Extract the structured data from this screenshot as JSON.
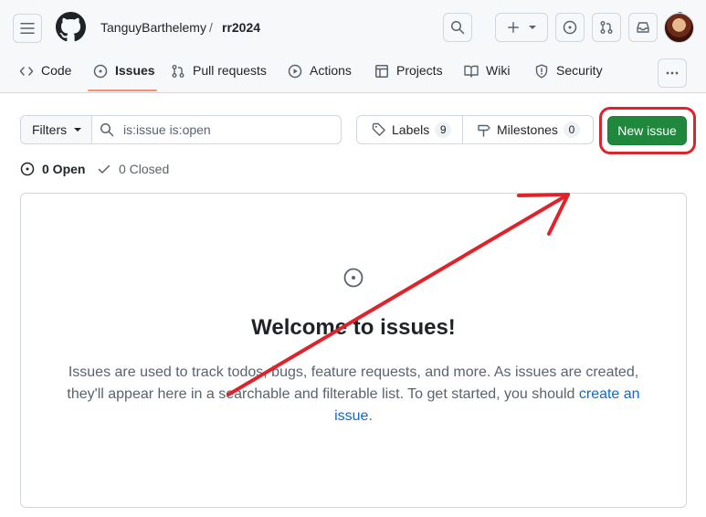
{
  "header": {
    "owner": "TanguyBarthelemy",
    "separator": "/",
    "repo": "rr2024"
  },
  "icons": {
    "menu": "hamburger-icon",
    "logo": "github-octocat-icon",
    "search": "search-icon",
    "create": "plus-icon",
    "issues": "issue-opened-icon",
    "pulls": "git-pull-request-icon",
    "inbox": "inbox-icon",
    "more": "kebab-horizontal-icon"
  },
  "tabs": [
    {
      "label": "Code",
      "icon": "code-icon"
    },
    {
      "label": "Issues",
      "icon": "issue-opened-icon",
      "active": true
    },
    {
      "label": "Pull requests",
      "icon": "git-pull-request-icon"
    },
    {
      "label": "Actions",
      "icon": "play-icon"
    },
    {
      "label": "Projects",
      "icon": "table-icon"
    },
    {
      "label": "Wiki",
      "icon": "book-icon"
    },
    {
      "label": "Security",
      "icon": "shield-icon"
    }
  ],
  "toolbar": {
    "filters_label": "Filters",
    "search_value": "is:issue is:open",
    "labels_label": "Labels",
    "labels_count": "9",
    "milestones_label": "Milestones",
    "milestones_count": "0",
    "new_issue_label": "New issue"
  },
  "states": {
    "open_label": "0 Open",
    "closed_label": "0 Closed"
  },
  "empty": {
    "title": "Welcome to issues!",
    "desc_before": "Issues are used to track todos, bugs, feature requests, and more. As issues are created, they'll appear here in a searchable and filterable list. To get started, you should",
    "link_text": "create an issue",
    "desc_after": "."
  },
  "colors": {
    "accent_green": "#1f883d",
    "link_blue": "#0969da",
    "tab_underline": "#fd8c73",
    "annotation_red": "#e0232b"
  }
}
